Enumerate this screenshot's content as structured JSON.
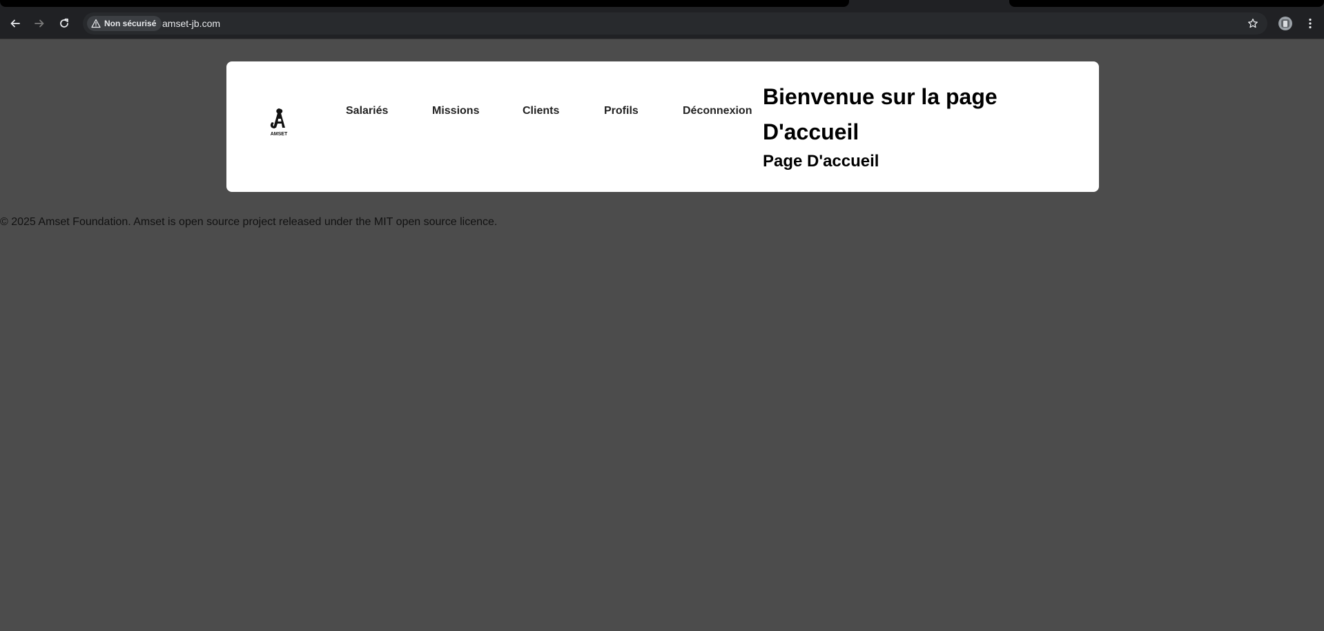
{
  "browser": {
    "security_label": "Non sécurisé",
    "url": "amset-jb.com"
  },
  "icons": {
    "back": "arrow-left-icon",
    "forward": "arrow-right-icon",
    "reload": "reload-icon",
    "warning": "warning-triangle-icon",
    "star": "star-icon",
    "profile": "profile-avatar-icon",
    "menu": "kebab-menu-icon"
  },
  "header": {
    "logo_alt": "AMSET",
    "nav": {
      "salaries": "Salariés",
      "missions": "Missions",
      "clients": "Clients",
      "profils": "Profils",
      "deconnexion": "Déconnexion"
    },
    "title": "Bienvenue sur la page D'accueil",
    "subtitle": "Page D'accueil"
  },
  "footer": {
    "text": "© 2025 Amset Foundation. Amset is open source project released under the MIT open source licence."
  },
  "colors": {
    "page_background": "#4c4c4c",
    "card_background": "#ffffff",
    "browser_chrome": "#202124"
  }
}
